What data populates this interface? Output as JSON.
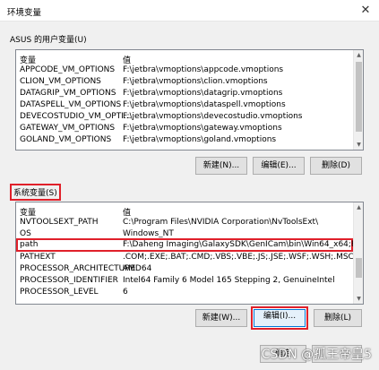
{
  "window": {
    "title": "环境变量"
  },
  "user_vars": {
    "label": "ASUS 的用户变量(U)",
    "columns": [
      "变量",
      "值"
    ],
    "rows": [
      [
        "APPCODE_VM_OPTIONS",
        "F:\\jetbra\\vmoptions\\appcode.vmoptions"
      ],
      [
        "CLION_VM_OPTIONS",
        "F:\\jetbra\\vmoptions\\clion.vmoptions"
      ],
      [
        "DATAGRIP_VM_OPTIONS",
        "F:\\jetbra\\vmoptions\\datagrip.vmoptions"
      ],
      [
        "DATASPELL_VM_OPTIONS",
        "F:\\jetbra\\vmoptions\\dataspell.vmoptions"
      ],
      [
        "DEVECOSTUDIO_VM_OPTI...",
        "F:\\jetbra\\vmoptions\\devecostudio.vmoptions"
      ],
      [
        "GATEWAY_VM_OPTIONS",
        "F:\\jetbra\\vmoptions\\gateway.vmoptions"
      ],
      [
        "GOLAND_VM_OPTIONS",
        "F:\\jetbra\\vmoptions\\goland.vmoptions"
      ]
    ],
    "buttons": {
      "new": "新建(N)...",
      "edit": "编辑(E)...",
      "delete": "删除(D)"
    }
  },
  "system_vars": {
    "label": "系统变量(S)",
    "columns": [
      "变量",
      "值"
    ],
    "rows": [
      [
        "NVTOOLSEXT_PATH",
        "C:\\Program Files\\NVIDIA Corporation\\NvToolsExt\\"
      ],
      [
        "OS",
        "Windows_NT"
      ],
      [
        "path",
        "F:\\Daheng Imaging\\GalaxySDK\\GenICam\\bin\\Win64_x64;F:\\Dah..."
      ],
      [
        "PATHEXT",
        ".COM;.EXE;.BAT;.CMD;.VBS;.VBE;.JS;.JSE;.WSF;.WSH;.MSC"
      ],
      [
        "PROCESSOR_ARCHITECTURE",
        "AMD64"
      ],
      [
        "PROCESSOR_IDENTIFIER",
        "Intel64 Family 6 Model 165 Stepping 2, GenuineIntel"
      ],
      [
        "PROCESSOR_LEVEL",
        "6"
      ]
    ],
    "buttons": {
      "new": "新建(W)...",
      "edit": "编辑(I)...",
      "delete": "删除(L)"
    }
  },
  "footer": {
    "ok": "确定"
  },
  "watermark": "CSDN @孤王帝皇5",
  "colors": {
    "highlight_red": "#e0202a",
    "focus_blue": "#0078d7"
  },
  "icons": {
    "close": "close-icon"
  }
}
